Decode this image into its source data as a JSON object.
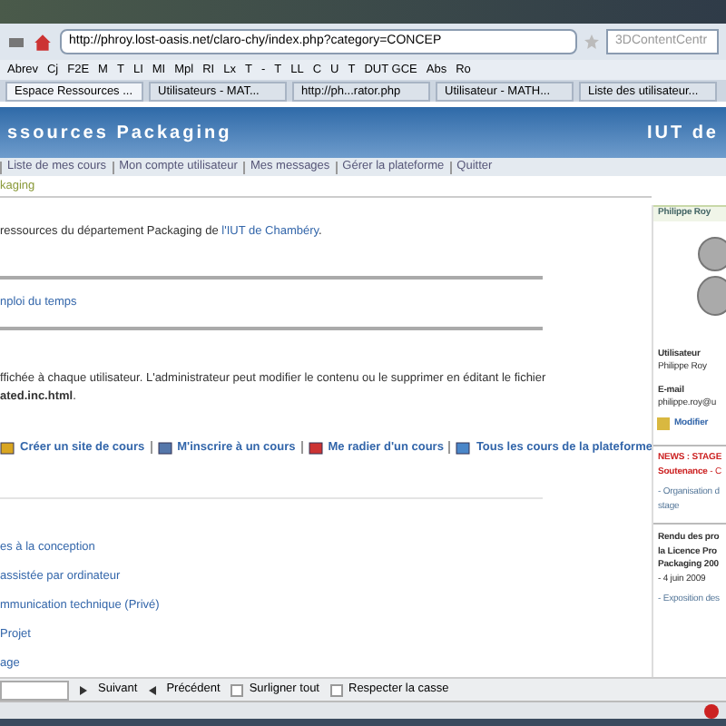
{
  "address_bar": {
    "url": "http://phroy.lost-oasis.net/claro-chy/index.php?category=CONCEP",
    "search_placeholder": "3DContentCentr"
  },
  "bookmarks": [
    "Abrev",
    "Cj",
    "F2E",
    "M",
    "T",
    "LI",
    "MI",
    "Mpl",
    "RI",
    "Lx",
    "T",
    "-",
    "T",
    "LL",
    "C",
    "U",
    "T",
    "DUT GCE",
    "Abs",
    "Ro"
  ],
  "tabs": [
    {
      "label": "Espace Ressources ...",
      "selected": true
    },
    {
      "label": "Utilisateurs - MAT...",
      "selected": false
    },
    {
      "label": "http://ph...rator.php",
      "selected": false
    },
    {
      "label": "Utilisateur - MATH...",
      "selected": false
    },
    {
      "label": "Liste des utilisateur...",
      "selected": false
    }
  ],
  "site_header": {
    "title": "ssources Packaging",
    "institution": "IUT de"
  },
  "nav": [
    "Liste de mes cours",
    "Mon compte utilisateur",
    "Mes messages",
    "Gérer la plateforme",
    "Quitter"
  ],
  "breadcrumb": "kaging",
  "intro": {
    "text": "ressources du département Packaging de ",
    "link": "l'IUT de Chambéry",
    "end": "."
  },
  "schedule_link": "nploi du temps",
  "notice": {
    "text": "ffichée à chaque utilisateur. L'administrateur peut modifier le contenu ou le supprimer en éditant le fichier",
    "file": "ated.inc.html",
    "end": "."
  },
  "actions": [
    {
      "label": "Créer un site de cours",
      "kind": "create"
    },
    {
      "label": "M'inscrire à un cours",
      "kind": "enroll"
    },
    {
      "label": "Me radier d'un cours",
      "kind": "remove"
    },
    {
      "label": "Tous les cours de la plateforme",
      "kind": "all"
    }
  ],
  "categories": [
    "es à la conception",
    "assistée par ordinateur",
    "mmunication technique (Privé)",
    "Projet",
    "age"
  ],
  "user_panel": {
    "name": "Philippe Roy",
    "role_label": "Utilisateur",
    "role_value": "Philippe Roy",
    "email_label": "E-mail",
    "email_value": "philippe.roy@u",
    "edit": "Modifier"
  },
  "news": {
    "title": "NEWS : STAGE",
    "subtitle": "Soutenance",
    "subtitle_rest": " - C",
    "items": [
      {
        "lines": [
          "- Organisation d",
          "stage"
        ]
      }
    ],
    "headline": [
      "Rendu des pro",
      "la Licence Pro",
      "Packaging 200"
    ],
    "date": "- 4 juin 2009",
    "more": "- Exposition des"
  },
  "find_bar": {
    "next": "Suivant",
    "previous": "Précédent",
    "options": [
      {
        "label": "Surligner tout",
        "checked": false
      },
      {
        "label": "Respecter la casse",
        "checked": false
      }
    ]
  }
}
